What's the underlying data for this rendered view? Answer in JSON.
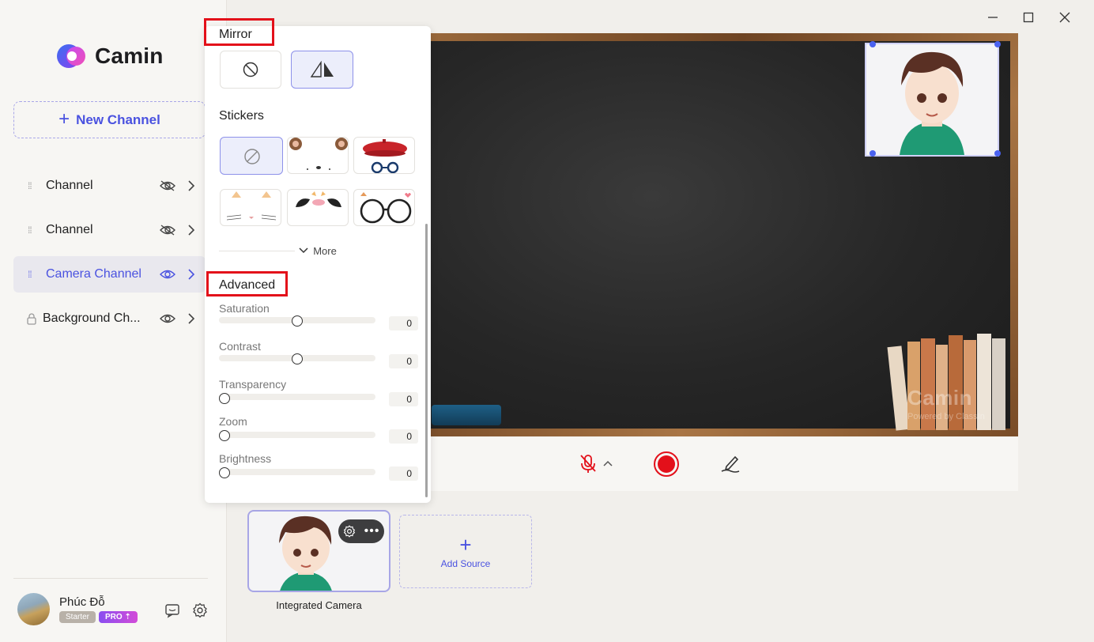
{
  "app": {
    "name": "Camin"
  },
  "sidebar": {
    "new_channel_label": "New Channel",
    "channels": [
      {
        "label": "Channel",
        "visible": false,
        "locked": false,
        "active": false
      },
      {
        "label": "Channel",
        "visible": false,
        "locked": false,
        "active": false
      },
      {
        "label": "Camera Channel",
        "visible": true,
        "locked": false,
        "active": true
      },
      {
        "label": "Background Ch...",
        "visible": true,
        "locked": true,
        "active": false
      }
    ],
    "user": {
      "name": "Phúc Đỗ",
      "plan": "Starter",
      "pro_label": "PRO"
    }
  },
  "panel": {
    "mirror_title": "Mirror",
    "stickers_title": "Stickers",
    "more_label": "More",
    "advanced_title": "Advanced",
    "sliders": [
      {
        "label": "Saturation",
        "value": "0",
        "position": 0.5
      },
      {
        "label": "Contrast",
        "value": "0",
        "position": 0.5
      },
      {
        "label": "Transparency",
        "value": "0",
        "position": 0
      },
      {
        "label": "Zoom",
        "value": "0",
        "position": 0
      },
      {
        "label": "Brightness",
        "value": "0",
        "position": 0
      }
    ]
  },
  "preview": {
    "watermark_title": "Camin",
    "watermark_sub": "Powered by ClassIn"
  },
  "sources": {
    "items": [
      {
        "label": "Integrated Camera"
      }
    ],
    "add_label": "Add Source"
  },
  "colors": {
    "accent": "#4a52e0",
    "record": "#e3101a",
    "highlight": "#e3101a"
  }
}
